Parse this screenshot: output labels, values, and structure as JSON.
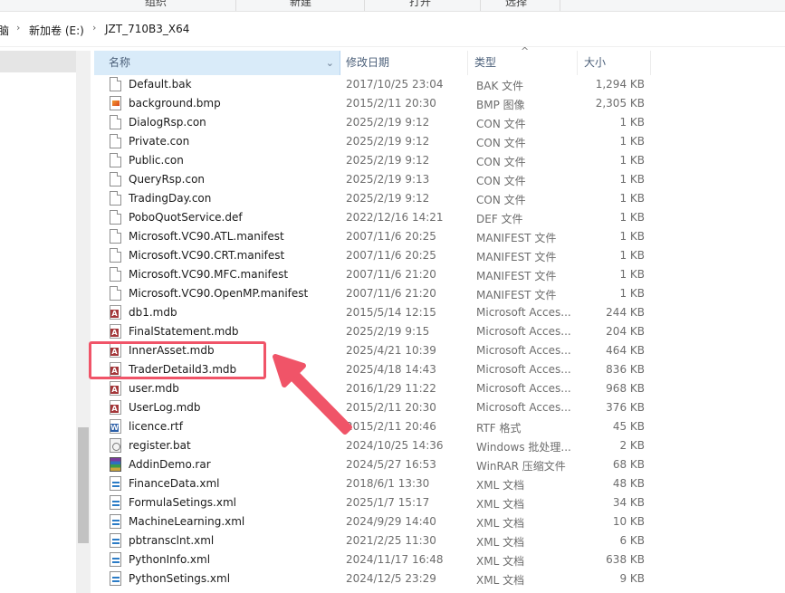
{
  "ribbon": {
    "groups": [
      "组织",
      "新建",
      "打开",
      "选择"
    ]
  },
  "address": {
    "crumbs": [
      "脑",
      "新加卷 (E:)",
      "JZT_710B3_X64"
    ]
  },
  "columns": {
    "name": "名称",
    "date": "修改日期",
    "type": "类型",
    "size": "大小"
  },
  "files": [
    {
      "name": "Default.bak",
      "date": "2017/10/25 23:04",
      "type": "BAK 文件",
      "size": "1,294 KB",
      "icon": "generic-file-icon"
    },
    {
      "name": "background.bmp",
      "date": "2015/2/11 20:30",
      "type": "BMP 图像",
      "size": "2,305 KB",
      "icon": "bitmap-image-icon"
    },
    {
      "name": "DialogRsp.con",
      "date": "2025/2/19 9:12",
      "type": "CON 文件",
      "size": "1 KB",
      "icon": "generic-file-icon"
    },
    {
      "name": "Private.con",
      "date": "2025/2/19 9:12",
      "type": "CON 文件",
      "size": "1 KB",
      "icon": "generic-file-icon"
    },
    {
      "name": "Public.con",
      "date": "2025/2/19 9:12",
      "type": "CON 文件",
      "size": "1 KB",
      "icon": "generic-file-icon"
    },
    {
      "name": "QueryRsp.con",
      "date": "2025/2/19 9:13",
      "type": "CON 文件",
      "size": "1 KB",
      "icon": "generic-file-icon"
    },
    {
      "name": "TradingDay.con",
      "date": "2025/2/19 9:12",
      "type": "CON 文件",
      "size": "1 KB",
      "icon": "generic-file-icon"
    },
    {
      "name": "PoboQuotService.def",
      "date": "2022/12/16 14:21",
      "type": "DEF 文件",
      "size": "1 KB",
      "icon": "generic-file-icon"
    },
    {
      "name": "Microsoft.VC90.ATL.manifest",
      "date": "2007/11/6 20:25",
      "type": "MANIFEST 文件",
      "size": "1 KB",
      "icon": "generic-file-icon"
    },
    {
      "name": "Microsoft.VC90.CRT.manifest",
      "date": "2007/11/6 20:25",
      "type": "MANIFEST 文件",
      "size": "1 KB",
      "icon": "generic-file-icon"
    },
    {
      "name": "Microsoft.VC90.MFC.manifest",
      "date": "2007/11/6 21:20",
      "type": "MANIFEST 文件",
      "size": "1 KB",
      "icon": "generic-file-icon"
    },
    {
      "name": "Microsoft.VC90.OpenMP.manifest",
      "date": "2007/11/6 21:20",
      "type": "MANIFEST 文件",
      "size": "1 KB",
      "icon": "generic-file-icon"
    },
    {
      "name": "db1.mdb",
      "date": "2015/5/14 12:15",
      "type": "Microsoft Acces...",
      "size": "244 KB",
      "icon": "access-database-icon"
    },
    {
      "name": "FinalStatement.mdb",
      "date": "2025/2/19 9:15",
      "type": "Microsoft Acces...",
      "size": "204 KB",
      "icon": "access-database-icon"
    },
    {
      "name": "InnerAsset.mdb",
      "date": "2025/4/21 10:39",
      "type": "Microsoft Acces...",
      "size": "464 KB",
      "icon": "access-database-icon"
    },
    {
      "name": "TraderDetaild3.mdb",
      "date": "2025/4/18 14:43",
      "type": "Microsoft Acces...",
      "size": "836 KB",
      "icon": "access-database-icon"
    },
    {
      "name": "user.mdb",
      "date": "2016/1/29 11:22",
      "type": "Microsoft Acces...",
      "size": "968 KB",
      "icon": "access-database-icon"
    },
    {
      "name": "UserLog.mdb",
      "date": "2015/2/11 20:30",
      "type": "Microsoft Acces...",
      "size": "376 KB",
      "icon": "access-database-icon"
    },
    {
      "name": "licence.rtf",
      "date": "2015/2/11 20:46",
      "type": "RTF 格式",
      "size": "45 KB",
      "icon": "word-document-icon"
    },
    {
      "name": "register.bat",
      "date": "2024/10/25 14:36",
      "type": "Windows 批处理...",
      "size": "2 KB",
      "icon": "batch-file-icon"
    },
    {
      "name": "AddinDemo.rar",
      "date": "2024/5/27 16:53",
      "type": "WinRAR 压缩文件",
      "size": "68 KB",
      "icon": "winrar-archive-icon"
    },
    {
      "name": "FinanceData.xml",
      "date": "2018/6/1 13:30",
      "type": "XML 文档",
      "size": "48 KB",
      "icon": "xml-document-icon"
    },
    {
      "name": "FormulaSetings.xml",
      "date": "2025/1/7 15:17",
      "type": "XML 文档",
      "size": "34 KB",
      "icon": "xml-document-icon"
    },
    {
      "name": "MachineLearning.xml",
      "date": "2024/9/29 14:40",
      "type": "XML 文档",
      "size": "10 KB",
      "icon": "xml-document-icon"
    },
    {
      "name": "pbtransclnt.xml",
      "date": "2021/2/25 11:30",
      "type": "XML 文档",
      "size": "6 KB",
      "icon": "xml-document-icon"
    },
    {
      "name": "PythonInfo.xml",
      "date": "2024/11/17 16:48",
      "type": "XML 文档",
      "size": "638 KB",
      "icon": "xml-document-icon"
    },
    {
      "name": "PythonSetings.xml",
      "date": "2024/12/5 23:29",
      "type": "XML 文档",
      "size": "9 KB",
      "icon": "xml-document-icon"
    }
  ],
  "annotation": {
    "highlight_color": "#f05468"
  }
}
